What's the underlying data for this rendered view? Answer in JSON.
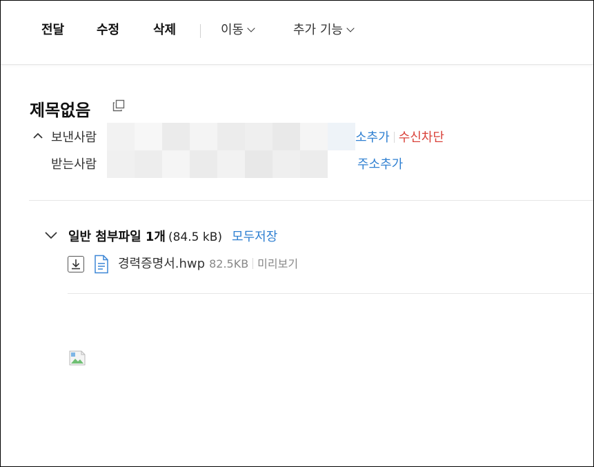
{
  "toolbar": {
    "forward": "전달",
    "edit": "수정",
    "delete": "삭제",
    "move": "이동",
    "more": "추가 기능"
  },
  "mail": {
    "subject": "제목없음",
    "sender_label": "보낸사람",
    "receiver_label": "받는사람",
    "sender_add_contact_partial": "소추가",
    "block_sender": "수신차단",
    "receiver_add_contact": "주소추가"
  },
  "attachments": {
    "title": "일반 첨부파일 1개",
    "total_size": "(84.5 kB)",
    "save_all": "모두저장",
    "files": [
      {
        "name": "경력증명서.hwp",
        "size": "82.5KB",
        "preview": "미리보기"
      }
    ]
  },
  "colors": {
    "link": "#2e7fd1",
    "danger": "#d9423a"
  }
}
